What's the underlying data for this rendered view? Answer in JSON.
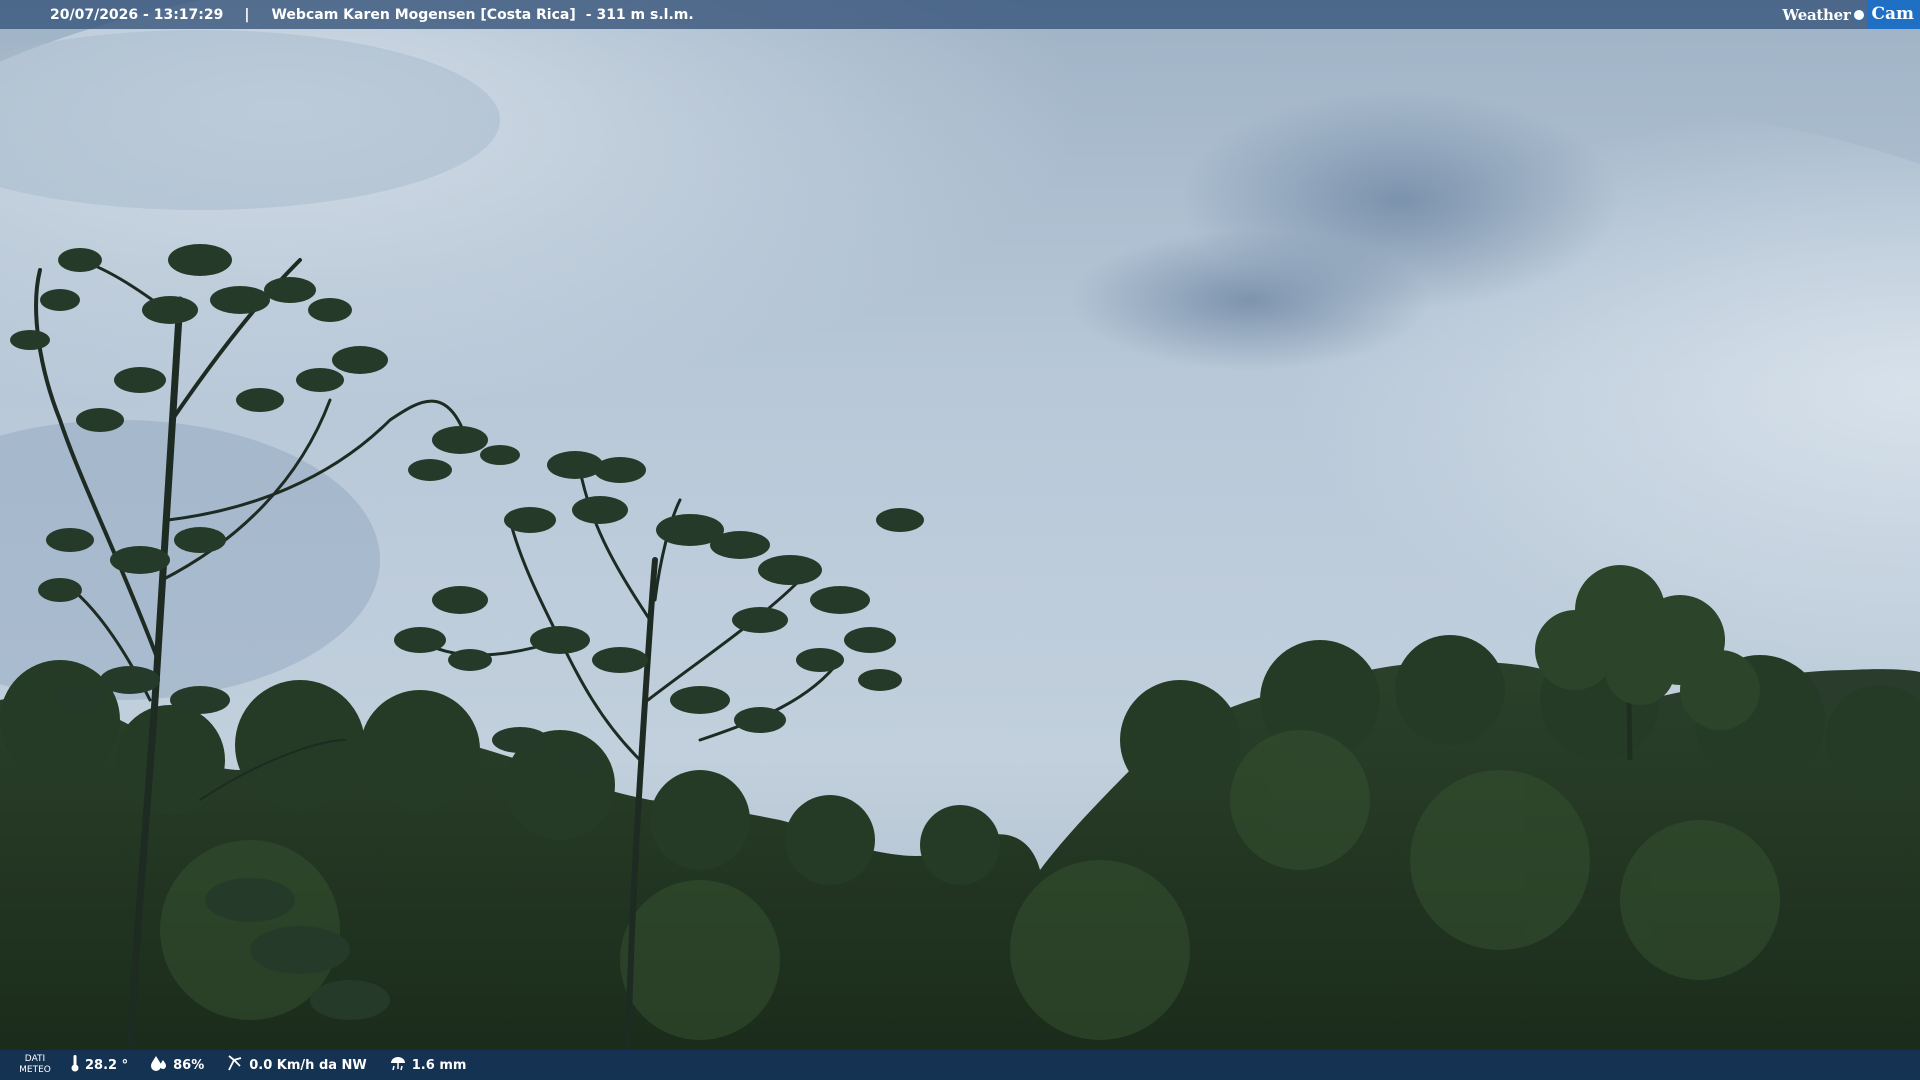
{
  "header": {
    "datetime": "20/07/2026 - 13:17:29",
    "separator": "|",
    "camera_title": "Webcam Karen Mogensen [Costa Rica]",
    "altitude": "- 311 m s.l.m.",
    "brand_left": "Weather",
    "brand_right": "Cam"
  },
  "footer": {
    "dati_label_1": "DATI",
    "dati_label_2": "METEO",
    "temperature": "28.2 °",
    "humidity": "86%",
    "wind": "0.0 Km/h da NW",
    "rain": "1.6 mm",
    "icons": {
      "temperature": "thermometer-icon",
      "humidity": "humidity-drop-icon",
      "wind": "wind-icon",
      "rain": "rain-icon"
    }
  },
  "colors": {
    "top_bar": "#345278",
    "bottom_bar": "#14345c",
    "brand_blue": "#1f6fc4",
    "sky": "#b9c9d8",
    "forest": "#1f3220"
  }
}
